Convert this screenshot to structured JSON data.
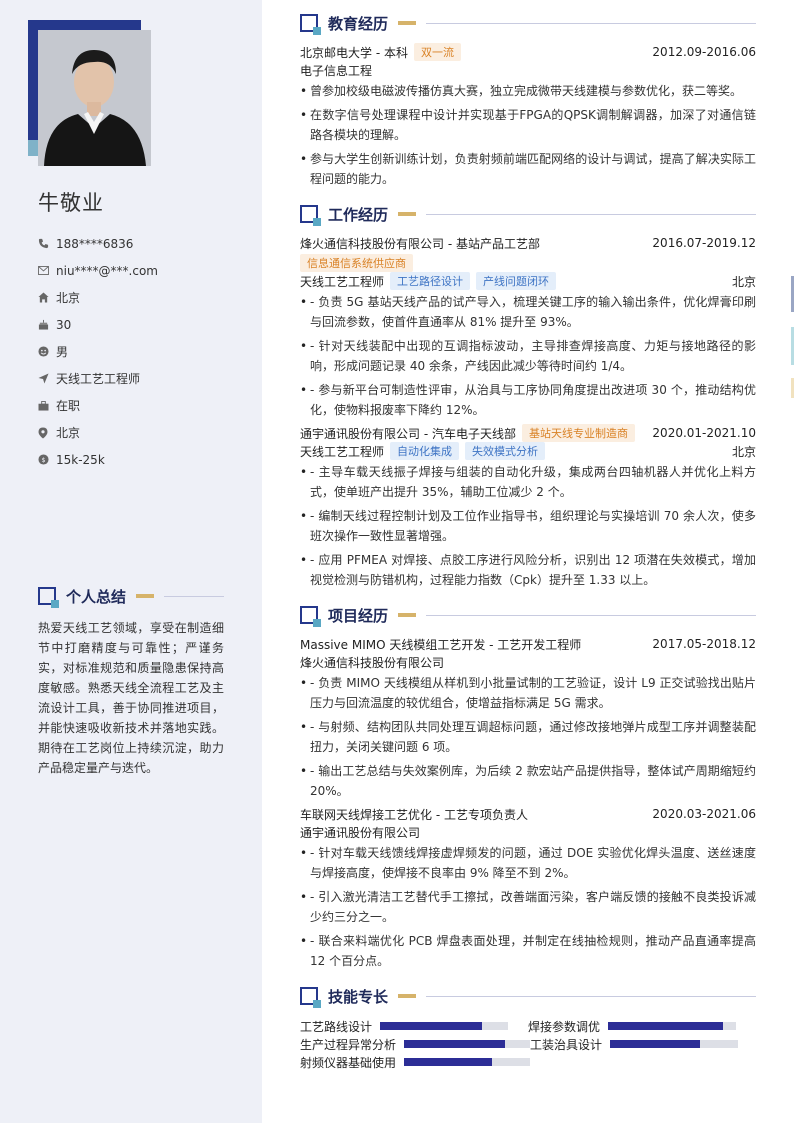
{
  "profile": {
    "name": "牛敬业",
    "contacts": [
      {
        "icon": "phone-icon",
        "value": "188****6836"
      },
      {
        "icon": "mail-icon",
        "value": "niu****@***.com"
      },
      {
        "icon": "home-icon",
        "value": "北京"
      },
      {
        "icon": "cake-icon",
        "value": "30"
      },
      {
        "icon": "gender-icon",
        "value": "男"
      },
      {
        "icon": "send-icon",
        "value": "天线工艺工程师"
      },
      {
        "icon": "briefcase-icon",
        "value": "在职"
      },
      {
        "icon": "location-pin-icon",
        "value": "北京"
      },
      {
        "icon": "salary-icon",
        "value": "15k-25k"
      }
    ]
  },
  "summary": {
    "title": "个人总结",
    "text": "热爱天线工艺领域，享受在制造细节中打磨精度与可靠性；严谨务实，对标准规范和质量隐患保持高度敏感。熟悉天线全流程工艺及主流设计工具，善于协同推进项目，并能快速吸收新技术并落地实践。期待在工艺岗位上持续沉淀，助力产品稳定量产与迭代。"
  },
  "education": {
    "title": "教育经历",
    "school": "北京邮电大学 - 本科",
    "tag": "双一流",
    "period": "2012.09-2016.06",
    "major": "电子信息工程",
    "bullets": [
      "曾参加校级电磁波传播仿真大赛，独立完成微带天线建模与参数优化，获二等奖。",
      "在数字信号处理课程中设计并实现基于FPGA的QPSK调制解调器，加深了对通信链路各模块的理解。",
      "参与大学生创新训练计划，负责射频前端匹配网络的设计与调试，提高了解决实际工程问题的能力。"
    ]
  },
  "work": {
    "title": "工作经历",
    "jobs": [
      {
        "company": "烽火通信科技股份有限公司 - 基站产品工艺部",
        "period": "2016.07-2019.12",
        "company_tag": "信息通信系统供应商",
        "role": "天线工艺工程师",
        "role_tags": [
          "工艺路径设计",
          "产线问题闭环"
        ],
        "city": "北京",
        "bullets": [
          "- 负责 5G 基站天线产品的试产导入，梳理关键工序的输入输出条件，优化焊膏印刷与回流参数，使首件直通率从 81% 提升至 93%。",
          "- 针对天线装配中出现的互调指标波动，主导排查焊接高度、力矩与接地路径的影响，形成问题记录 40 余条，产线因此减少等待时间约 1/4。",
          "- 参与新平台可制造性评审，从治具与工序协同角度提出改进项 30 个，推动结构优化，使物料报废率下降约 12%。"
        ]
      },
      {
        "company": "通宇通讯股份有限公司 - 汽车电子天线部",
        "period": "2020.01-2021.10",
        "company_tag": "基站天线专业制造商",
        "role": "天线工艺工程师",
        "role_tags": [
          "自动化集成",
          "失效模式分析"
        ],
        "city": "北京",
        "bullets": [
          "- 主导车载天线振子焊接与组装的自动化升级，集成两台四轴机器人并优化上料方式，使单班产出提升 35%，辅助工位减少 2 个。",
          "- 编制天线过程控制计划及工位作业指导书，组织理论与实操培训 70 余人次，使多班次操作一致性显著增强。",
          "- 应用 PFMEA 对焊接、点胶工序进行风险分析，识别出 12 项潜在失效模式，增加视觉检测与防错机构，过程能力指数（Cpk）提升至 1.33 以上。"
        ]
      }
    ]
  },
  "projects": {
    "title": "项目经历",
    "items": [
      {
        "name": "Massive MIMO 天线模组工艺开发 - 工艺开发工程师",
        "period": "2017.05-2018.12",
        "org": "烽火通信科技股份有限公司",
        "bullets": [
          "- 负责 MIMO 天线模组从样机到小批量试制的工艺验证，设计 L9 正交试验找出贴片压力与回流温度的较优组合，使增益指标满足 5G 需求。",
          "- 与射频、结构团队共同处理互调超标问题，通过修改接地弹片成型工序并调整装配扭力，关闭关键问题 6 项。",
          "- 输出工艺总结与失效案例库，为后续 2 款宏站产品提供指导，整体试产周期缩短约 20%。"
        ]
      },
      {
        "name": "车联网天线焊接工艺优化 - 工艺专项负责人",
        "period": "2020.03-2021.06",
        "org": "通宇通讯股份有限公司",
        "bullets": [
          "- 针对车载天线馈线焊接虚焊频发的问题，通过 DOE 实验优化焊头温度、送丝速度与焊接高度，使焊接不良率由 9% 降至不到 2%。",
          "- 引入激光清洁工艺替代手工擦拭，改善端面污染，客户端反馈的接触不良类投诉减少约三分之一。",
          "- 联合来料端优化 PCB 焊盘表面处理，并制定在线抽检规则，推动产品直通率提高 12 个百分点。"
        ]
      }
    ]
  },
  "skills": {
    "title": "技能专长",
    "items": [
      {
        "name": "工艺路线设计",
        "level": 0.8
      },
      {
        "name": "焊接参数调优",
        "level": 0.9
      },
      {
        "name": "生产过程异常分析",
        "level": 0.8
      },
      {
        "name": "工装治具设计",
        "level": 0.7
      },
      {
        "name": "射频仪器基础使用",
        "level": 0.7
      }
    ]
  },
  "colors": {
    "accent_navy": "#25388c",
    "accent_teal": "#5aa8c4",
    "accent_gold": "#d6b36a",
    "skill_fill": "#2c2d96"
  }
}
